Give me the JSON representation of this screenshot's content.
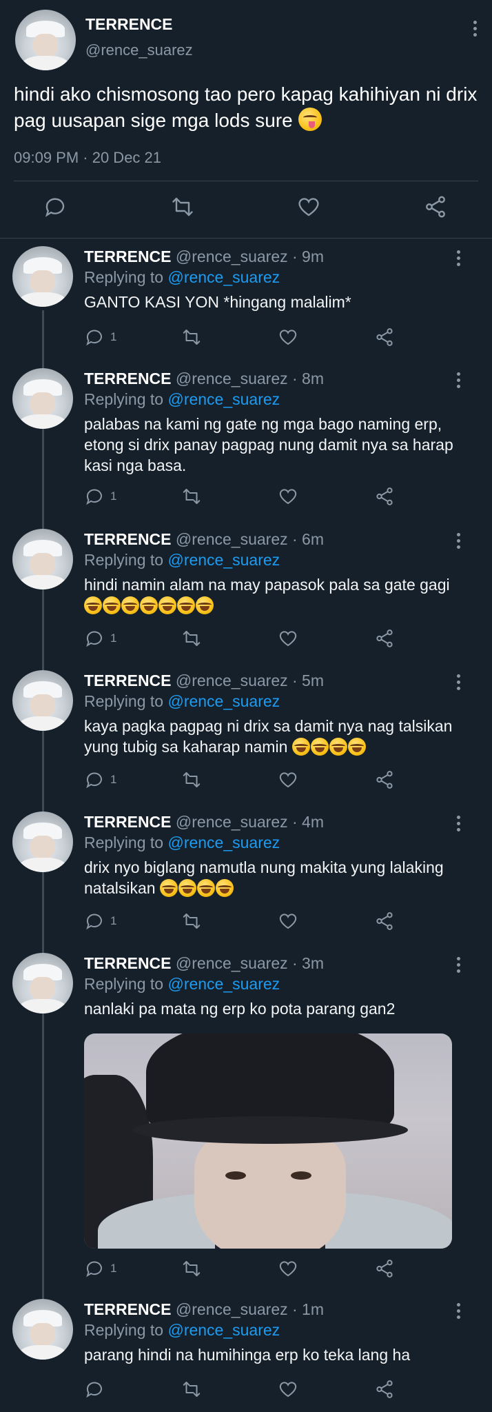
{
  "main": {
    "name": "TERRENCE",
    "handle": "@rence_suarez",
    "text": "hindi ako chismosong tao pero kapag kahihiyan ni drix pag uusapan sige mga lods sure",
    "emoji": "face-with-tongue",
    "time": "09:09 PM · 20 Dec 21"
  },
  "replies": [
    {
      "name": "TERRENCE",
      "meta": "@rence_suarez · 9m",
      "replying_label": "Replying to",
      "replying_to": "@rence_suarez",
      "text": "GANTO KASI YON *hingang malalim*",
      "reply_count": "1"
    },
    {
      "name": "TERRENCE",
      "meta": "@rence_suarez · 8m",
      "replying_label": "Replying to",
      "replying_to": "@rence_suarez",
      "text": "palabas na kami ng gate ng mga bago naming erp, etong si drix panay pagpag nung damit nya sa harap kasi nga basa.",
      "reply_count": "1"
    },
    {
      "name": "TERRENCE",
      "meta": "@rence_suarez · 6m",
      "replying_label": "Replying to",
      "replying_to": "@rence_suarez",
      "text": "hindi namin alam na may papasok pala sa gate gagi",
      "emoji_count": 7,
      "reply_count": "1"
    },
    {
      "name": "TERRENCE",
      "meta": "@rence_suarez · 5m",
      "replying_label": "Replying to",
      "replying_to": "@rence_suarez",
      "text": "kaya pagka pagpag ni drix sa damit nya nag talsikan yung tubig sa kaharap namin",
      "emoji_count": 4,
      "reply_count": "1"
    },
    {
      "name": "TERRENCE",
      "meta": "@rence_suarez · 4m",
      "replying_label": "Replying to",
      "replying_to": "@rence_suarez",
      "text": "drix nyo biglang namutla nung makita yung lalaking natalsikan",
      "emoji_count": 4,
      "reply_count": "1"
    },
    {
      "name": "TERRENCE",
      "meta": "@rence_suarez · 3m",
      "replying_label": "Replying to",
      "replying_to": "@rence_suarez",
      "text": "nanlaki pa mata ng erp ko pota parang gan2",
      "reply_count": "1"
    },
    {
      "name": "TERRENCE",
      "meta": "@rence_suarez · 1m",
      "replying_label": "Replying to",
      "replying_to": "@rence_suarez",
      "text": "parang hindi na humihinga erp ko teka lang ha",
      "reply_count": ""
    }
  ],
  "emoji_name": "rolling-on-the-floor-laughing",
  "colors": {
    "background": "#15202b",
    "link": "#1d9bf0",
    "muted": "#8b98a5",
    "divider": "#38444d"
  }
}
